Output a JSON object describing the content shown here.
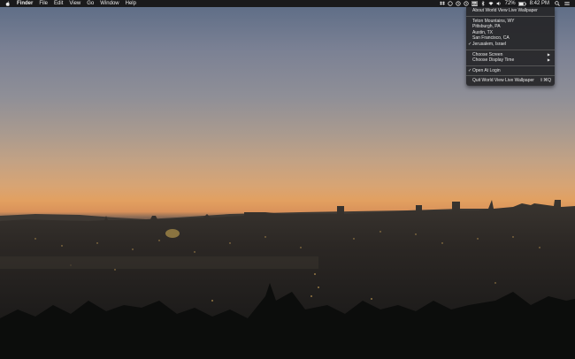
{
  "menubar": {
    "app_name": "Finder",
    "menus": [
      "File",
      "Edit",
      "View",
      "Go",
      "Window",
      "Help"
    ],
    "battery": "72%",
    "time": "8:42 PM"
  },
  "dropdown": {
    "about": "About World View Live Wallpaper",
    "locations": [
      {
        "label": "Teton Mountains, WY",
        "checked": false
      },
      {
        "label": "Pittsburgh, PA",
        "checked": false
      },
      {
        "label": "Austin, TX",
        "checked": false
      },
      {
        "label": "San Francisco, CA",
        "checked": false
      },
      {
        "label": "Jerusalem, Israel",
        "checked": true
      }
    ],
    "choose_screen": "Choose Screen",
    "choose_display_time": "Choose Display Time",
    "open_at_login": "Open At Login",
    "quit": "Quit World View Live Wallpaper",
    "quit_shortcut": "⇧⌘Q",
    "check_mark": "✓",
    "submenu_arrow": "▶"
  },
  "colors": {
    "menubar_bg": "#1a1a1c",
    "menu_bg": "#262628"
  }
}
